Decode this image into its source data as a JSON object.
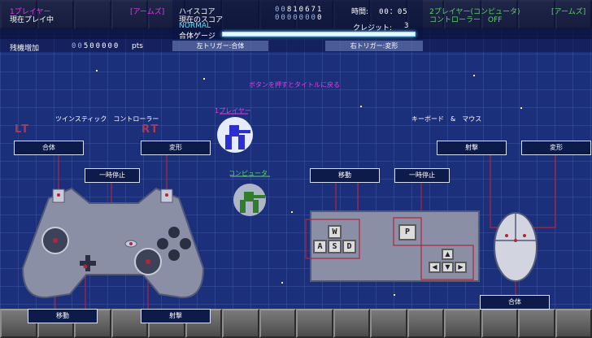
{
  "p1": {
    "label": "1プレイヤー",
    "status": "現在プレイ中",
    "weapon": "[アームズ]"
  },
  "p2": {
    "label": "2プレイヤー(コンピュータ)",
    "status": "コントローラー　OFF",
    "weapon": "[アームズ]"
  },
  "score": {
    "hi_label": "ハイスコア",
    "hi_prefix": "00",
    "hi_value": "810671",
    "cur_label": "現在のスコア",
    "cur_prefix": "0000000",
    "cur_value": "0",
    "mode": "NORMAL",
    "gauge_label": "合体ゲージ"
  },
  "time": {
    "label": "時間:",
    "value": "00：05"
  },
  "credit": {
    "label": "クレジット:",
    "value": "3"
  },
  "extend": {
    "label": "残機増加",
    "prefix": "00",
    "value": "500000",
    "unit": "pts"
  },
  "triggers": {
    "left": "左トリガー:合体",
    "right": "右トリガー:変形"
  },
  "hint": "ボタンを押すとタイトルに戻る",
  "controller": {
    "title": "ツインスティック　コントローラー",
    "lt": "LT",
    "rt": "RT",
    "gattai": "合体",
    "henkei": "変形",
    "pause": "一時停止",
    "move": "移動",
    "shoot": "射撃"
  },
  "player_tag": "1プレイヤー",
  "computer_tag": "コンピュータ",
  "keyboard": {
    "title": "キーボード　&　マウス",
    "move": "移動",
    "pause": "一時停止",
    "keys": [
      "W",
      "A",
      "S",
      "D"
    ],
    "pause_key": "P",
    "arrows": [
      "▲",
      "◀",
      "▼",
      "▶"
    ]
  },
  "mouse": {
    "shoot": "射撃",
    "henkei": "変形",
    "gattai": "合体"
  },
  "colors": {
    "magenta": "#e23be8",
    "green": "#5fd16a",
    "cyan": "#56e5ff",
    "line": "#b4243b"
  }
}
